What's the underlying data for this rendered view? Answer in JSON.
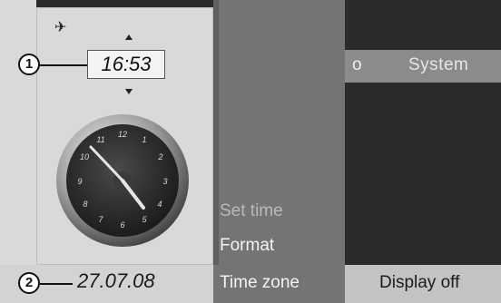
{
  "top_bar": {
    "left_fragment": "o",
    "system_label": "System"
  },
  "clock_panel": {
    "time": "16:53",
    "date": "27.07.08",
    "icons": {
      "satellite": "satellite-icon",
      "up": "arrow-up-icon",
      "down": "arrow-down-icon"
    }
  },
  "menu": {
    "items": [
      {
        "label": "Set time",
        "state": "dimmed"
      },
      {
        "label": "Format",
        "state": "normal"
      },
      {
        "label": "Time zone",
        "state": "normal"
      }
    ]
  },
  "right_bottom": {
    "display_off": "Display off"
  },
  "callouts": [
    "1",
    "2"
  ],
  "colors": {
    "panel": "#d9d9d9",
    "menu": "#747474",
    "dark": "#2a2a2a"
  }
}
